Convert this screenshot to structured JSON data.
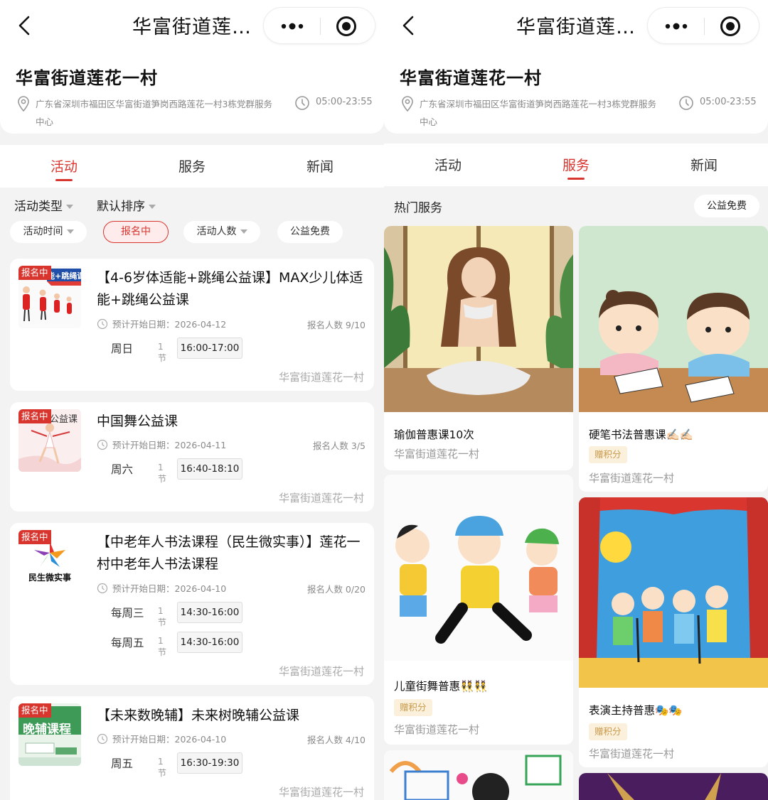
{
  "nav": {
    "title": "华富街道莲…"
  },
  "header": {
    "name": "华富街道莲花一村",
    "address": "广东省深圳市福田区华富街道笋岗西路莲花一村3栋党群服务中心",
    "hours": "05:00-23:55"
  },
  "tabs": [
    "活动",
    "服务",
    "新闻"
  ],
  "left": {
    "active_tab": "活动",
    "sort": {
      "type": "活动类型",
      "order": "默认排序"
    },
    "filters": [
      "活动时间",
      "报名中",
      "活动人数",
      "公益免费"
    ],
    "active_filter": "报名中",
    "activities": [
      {
        "badge": "报名中",
        "thumb_text": "能+跳绳课",
        "title": "【4-6岁体适能+跳绳公益课】MAX少儿体适能+跳绳公益课",
        "date": "预计开始日期：2026-04-12",
        "count": "报名人数 9/10",
        "schedule": [
          {
            "day": "周日",
            "sessions": "1节",
            "time": "16:00-17:00"
          }
        ],
        "venue": "华富街道莲花一村"
      },
      {
        "badge": "报名中",
        "thumb_text": "公益课",
        "title": "中国舞公益课",
        "date": "预计开始日期：2026-04-11",
        "count": "报名人数 3/5",
        "schedule": [
          {
            "day": "周六",
            "sessions": "1节",
            "time": "16:40-18:10"
          }
        ],
        "venue": "华富街道莲花一村"
      },
      {
        "badge": "报名中",
        "thumb_text": "民生微实事",
        "title": "【中老年人书法课程（民生微实事）】莲花一村中老年人书法课程",
        "date": "预计开始日期：2026-04-10",
        "count": "报名人数 0/20",
        "schedule": [
          {
            "day": "每周三",
            "sessions": "1节",
            "time": "14:30-16:00"
          },
          {
            "day": "每周五",
            "sessions": "1节",
            "time": "14:30-16:00"
          }
        ],
        "venue": "华富街道莲花一村"
      },
      {
        "badge": "报名中",
        "thumb_text": "晚辅课程",
        "title": "【未来数晚辅】未来树晚辅公益课",
        "date": "预计开始日期：2026-04-10",
        "count": "报名人数 4/10",
        "schedule": [
          {
            "day": "周五",
            "sessions": "1节",
            "time": "16:30-19:30"
          }
        ],
        "venue": "华富街道莲花一村"
      }
    ]
  },
  "right": {
    "active_tab": "服务",
    "hot_title": "热门服务",
    "free_filter": "公益免费",
    "services": [
      {
        "name": "瑜伽普惠课10次",
        "tag": "",
        "venue": "华富街道莲花一村"
      },
      {
        "name": "硬笔书法普惠课✍🏻✍🏻",
        "tag": "赠积分",
        "venue": "华富街道莲花一村"
      },
      {
        "name": "儿童街舞普惠👯👯",
        "tag": "赠积分",
        "venue": "华富街道莲花一村"
      },
      {
        "name": "表演主持普惠🎭🎭",
        "tag": "赠积分",
        "venue": "华富街道莲花一村"
      }
    ]
  },
  "colors": {
    "accent": "#d8352e",
    "points_bg": "#fbf0dc",
    "points_fg": "#c99a4a"
  }
}
